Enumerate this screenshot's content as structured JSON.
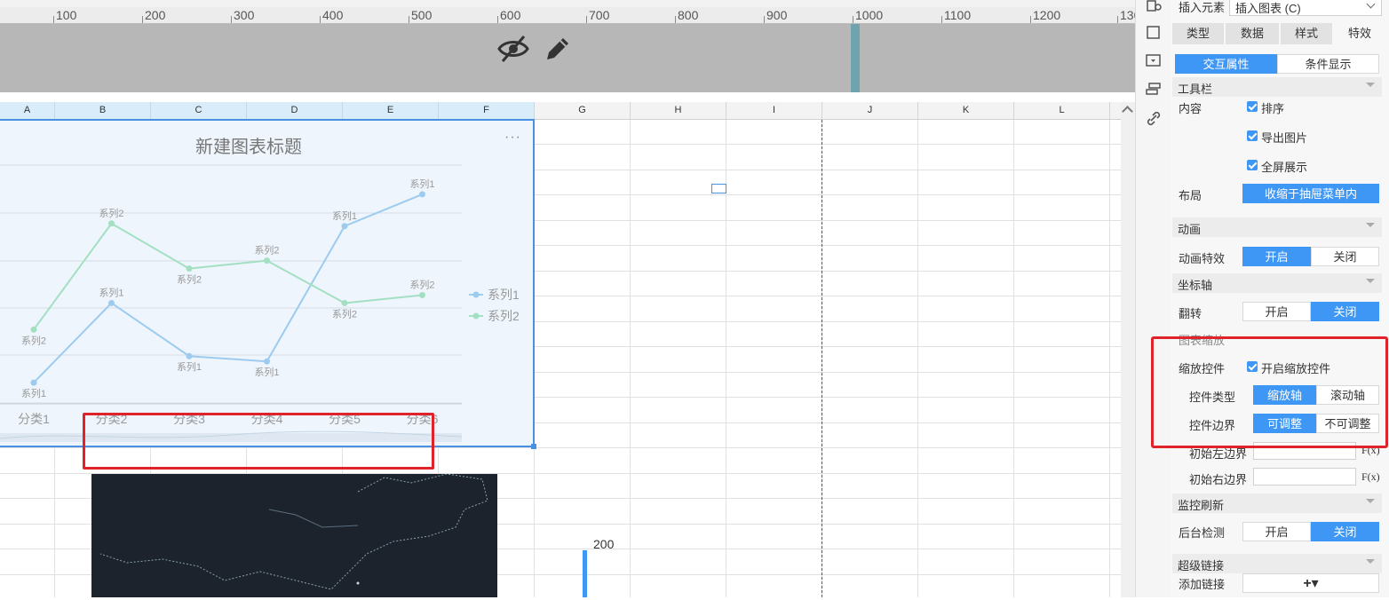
{
  "ruler": {
    "labels": [
      "100",
      "200",
      "300",
      "400",
      "500",
      "600",
      "700",
      "800",
      "900",
      "1000",
      "1100",
      "1200",
      "130"
    ]
  },
  "banner": {
    "hide_icon": "eye-slash-icon",
    "edit_icon": "pencil-icon"
  },
  "columns": [
    "A",
    "B",
    "C",
    "D",
    "E",
    "F",
    "G",
    "H",
    "I",
    "J",
    "K",
    "L"
  ],
  "chart": {
    "more": "···",
    "legend": [
      "系列1",
      "系列2"
    ]
  },
  "chart_data": {
    "type": "line",
    "title": "新建图表标题",
    "categories": [
      "分类1",
      "分类2",
      "分类3",
      "分类4",
      "分类5",
      "分类6"
    ],
    "series": [
      {
        "name": "系列1",
        "values": [
          1,
          4,
          2,
          1.8,
          6.9,
          8.1
        ]
      },
      {
        "name": "系列2",
        "values": [
          3,
          7,
          5.3,
          5.6,
          4,
          4.3
        ]
      }
    ],
    "colors": [
      "#9dcbef",
      "#a3e0c2"
    ],
    "ylim": [
      0,
      9
    ],
    "legend_position": "right",
    "grid": true
  },
  "map": {
    "value_label": "200"
  },
  "panel": {
    "insert_label": "插入元素",
    "insert_value": "插入图表 (C)",
    "tabs": [
      "类型",
      "数据",
      "样式",
      "特效"
    ],
    "subtabs": [
      "交互属性",
      "条件显示"
    ],
    "toolbar_section": "工具栏",
    "content_label": "内容",
    "checks": [
      "排序",
      "导出图片",
      "全屏展示"
    ],
    "layout_label": "布局",
    "layout_value": "收缩于抽屉菜单内",
    "animation_section": "动画",
    "anim_effect_label": "动画特效",
    "on": "开启",
    "off": "关闭",
    "axis_section": "坐标轴",
    "flip_label": "翻转",
    "zoom_section": "图表缩放",
    "zoom_ctrl_label": "缩放控件",
    "zoom_ctrl_check": "开启缩放控件",
    "ctrl_type_label": "控件类型",
    "ctrl_type_opts": [
      "缩放轴",
      "滚动轴"
    ],
    "ctrl_border_label": "控件边界",
    "ctrl_border_opts": [
      "可调整",
      "不可调整"
    ],
    "init_left_label": "初始左边界",
    "init_right_label": "初始右边界",
    "fx": "F(x)",
    "monitor_section": "监控刷新",
    "bg_check_label": "后台检测",
    "link_section": "超级链接",
    "add_link_label": "添加链接",
    "add_link_btn": "+▾"
  }
}
